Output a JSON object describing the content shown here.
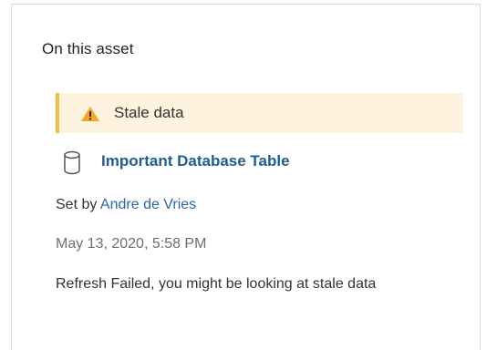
{
  "panel": {
    "title": "On this asset"
  },
  "warning": {
    "icon": "warning-triangle-icon",
    "label": "Stale data",
    "colors": {
      "background": "#fdf3df",
      "accent": "#f6bd3b"
    }
  },
  "asset": {
    "icon": "database-icon",
    "name": "Important Database Table",
    "link_color": "#1f5d92"
  },
  "meta": {
    "set_by_prefix": "Set by ",
    "author": "Andre de Vries",
    "timestamp": "May 13, 2020, 5:58 PM"
  },
  "message": "Refresh Failed, you might be looking at stale data"
}
